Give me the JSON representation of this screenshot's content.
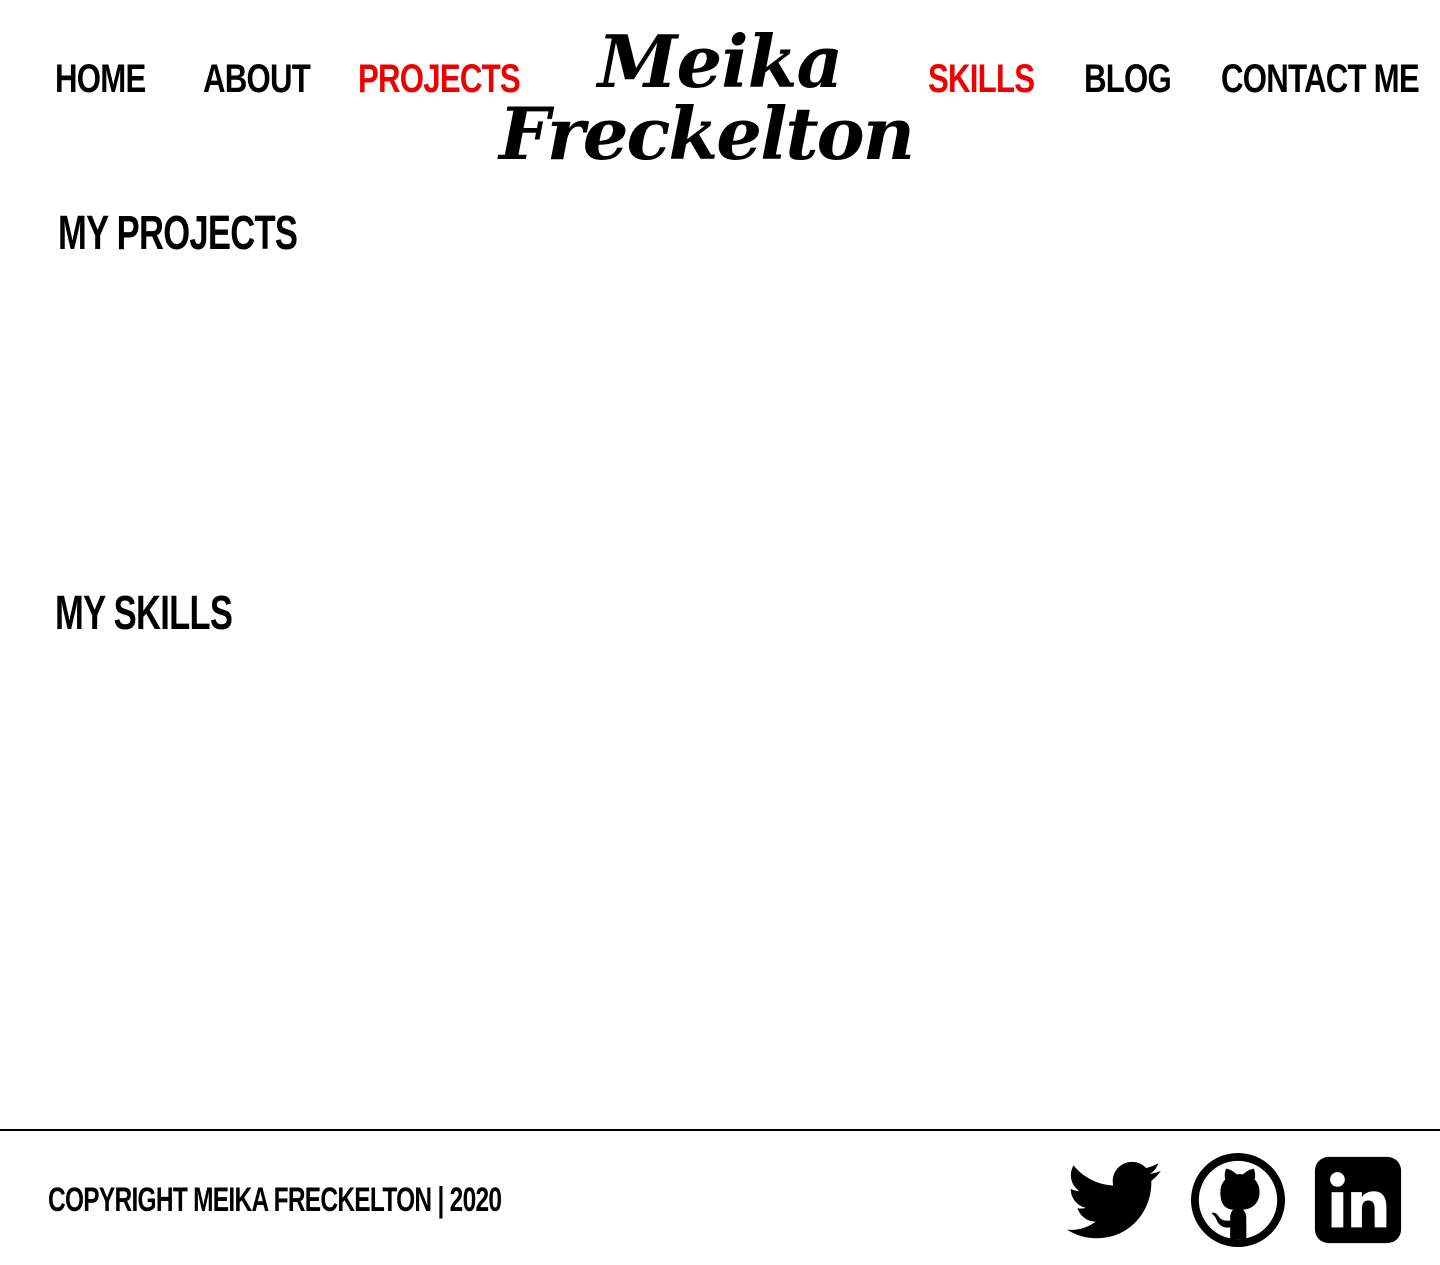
{
  "nav": {
    "home": "HOME",
    "about": "ABOUT",
    "projects": "PROJECTS",
    "skills": "SKILLS",
    "blog": "BLOG",
    "contact": "CONTACT ME"
  },
  "logo": {
    "line1": "Meika",
    "line2": "Freckelton"
  },
  "sections": {
    "projects_title": "MY PROJECTS",
    "skills_title": "MY SKILLS"
  },
  "footer": {
    "copyright": "COPYRIGHT MEIKA FRECKELTON | 2020",
    "social": [
      {
        "icon": "twitter-icon"
      },
      {
        "icon": "github-icon"
      },
      {
        "icon": "linkedin-icon"
      }
    ]
  },
  "colors": {
    "accent": "#ee0000",
    "text": "#000000",
    "background": "#ffffff"
  }
}
